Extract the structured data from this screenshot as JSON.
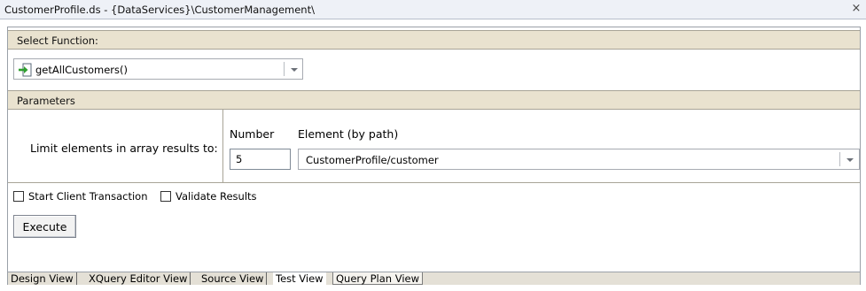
{
  "window": {
    "title": "CustomerProfile.ds - {DataServices}\\CustomerManagement\\",
    "close_glyph": "×"
  },
  "select_function": {
    "header": "Select Function:",
    "selected": "getAllCustomers()",
    "icon": "function-arrow-icon"
  },
  "parameters": {
    "header": "Parameters",
    "limit_label": "Limit elements in array results to:",
    "number_label": "Number",
    "number_value": "5",
    "element_label": "Element (by path)",
    "element_value": "CustomerProfile/customer"
  },
  "options": {
    "start_client_transaction": "Start Client Transaction",
    "validate_results": "Validate Results"
  },
  "execute_label": "Execute",
  "tabs": [
    {
      "label": "Design View"
    },
    {
      "label": "XQuery Editor View"
    },
    {
      "label": "Source View"
    },
    {
      "label": "Test View"
    },
    {
      "label": "Query Plan View"
    }
  ],
  "colors": {
    "section_header": "#e9e2cf",
    "icon_green": "#2f9e2f",
    "tabbar": "#e4e0d6"
  }
}
